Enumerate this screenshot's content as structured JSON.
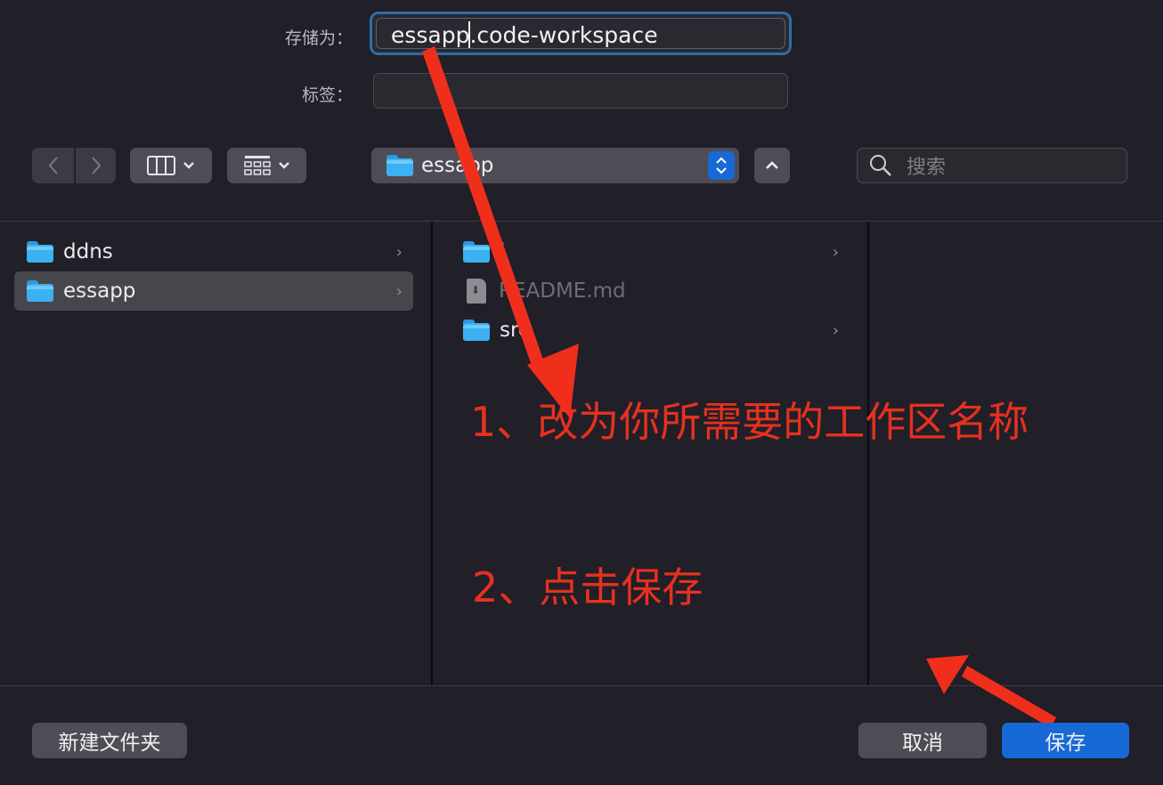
{
  "form": {
    "save_as_label": "存储为：",
    "save_as_value": "essapp.code-workspace",
    "tags_label": "标签：",
    "tags_value": ""
  },
  "toolbar": {
    "location": "essapp",
    "search_placeholder": "搜索"
  },
  "columns": {
    "first": [
      {
        "name": "ddns",
        "kind": "folder",
        "has_children": true,
        "selected": false
      },
      {
        "name": "essapp",
        "kind": "folder",
        "has_children": true,
        "selected": true
      }
    ],
    "second": [
      {
        "name": "l",
        "kind": "folder",
        "has_children": true
      },
      {
        "name": "README.md",
        "kind": "file",
        "has_children": false
      },
      {
        "name": "src",
        "kind": "folder",
        "has_children": true
      }
    ]
  },
  "annotations": {
    "step1": "1、改为你所需要的工作区名称",
    "step2": "2、点击保存"
  },
  "buttons": {
    "new_folder": "新建文件夹",
    "cancel": "取消",
    "save": "保存"
  },
  "colors": {
    "accent": "#1769d6",
    "annotation": "#e5311f",
    "folder": "#3ab1f2"
  }
}
